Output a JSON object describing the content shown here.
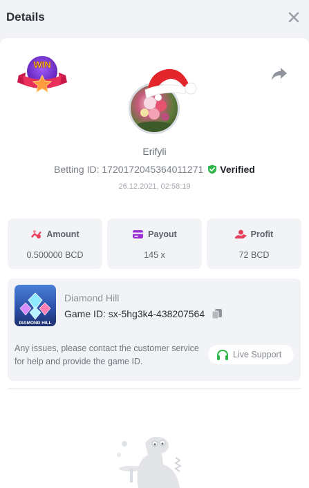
{
  "header": {
    "title": "Details"
  },
  "player": {
    "username": "Erifyli",
    "betting_id_label": "Betting ID:",
    "betting_id": "1720172045364011271",
    "verified_label": "Verified",
    "date": "26.12.2021, 02:58:19"
  },
  "badge": {
    "text": "WIN"
  },
  "stats": [
    {
      "label": "Amount",
      "value": "0.500000 BCD",
      "icon": "bet-amount-icon",
      "color": "#e8405a"
    },
    {
      "label": "Payout",
      "value": "145 x",
      "icon": "payout-card-icon",
      "color": "#9b2fd6"
    },
    {
      "label": "Profit",
      "value": "72 BCD",
      "icon": "profit-hand-icon",
      "color": "#e8405a"
    }
  ],
  "game": {
    "name": "Diamond Hill",
    "thumb_text": "DIAMOND HILL",
    "id_label": "Game ID:",
    "id_value": "sx-5hg3k4-438207564",
    "help_text": "Any issues, please contact the customer service for help and provide the game ID.",
    "support_label": "Live Support"
  },
  "colors": {
    "verified": "#2fb54a",
    "support_icon": "#2fb54a",
    "accent_red": "#e8405a"
  }
}
